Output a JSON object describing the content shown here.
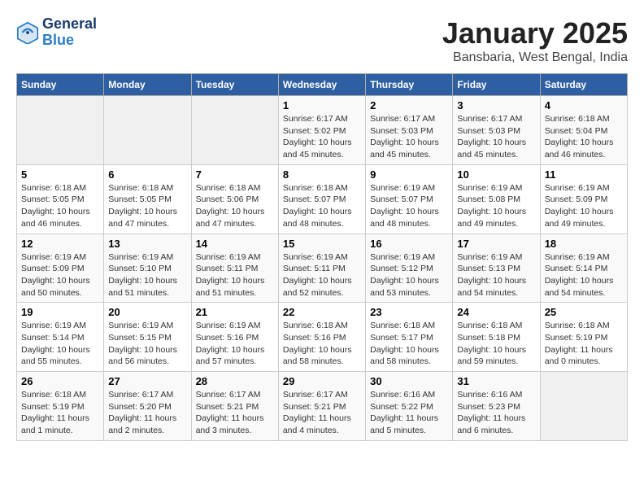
{
  "logo": {
    "line1": "General",
    "line2": "Blue"
  },
  "title": "January 2025",
  "subtitle": "Bansbaria, West Bengal, India",
  "weekdays": [
    "Sunday",
    "Monday",
    "Tuesday",
    "Wednesday",
    "Thursday",
    "Friday",
    "Saturday"
  ],
  "weeks": [
    [
      {
        "day": "",
        "info": ""
      },
      {
        "day": "",
        "info": ""
      },
      {
        "day": "",
        "info": ""
      },
      {
        "day": "1",
        "info": "Sunrise: 6:17 AM\nSunset: 5:02 PM\nDaylight: 10 hours\nand 45 minutes."
      },
      {
        "day": "2",
        "info": "Sunrise: 6:17 AM\nSunset: 5:03 PM\nDaylight: 10 hours\nand 45 minutes."
      },
      {
        "day": "3",
        "info": "Sunrise: 6:17 AM\nSunset: 5:03 PM\nDaylight: 10 hours\nand 45 minutes."
      },
      {
        "day": "4",
        "info": "Sunrise: 6:18 AM\nSunset: 5:04 PM\nDaylight: 10 hours\nand 46 minutes."
      }
    ],
    [
      {
        "day": "5",
        "info": "Sunrise: 6:18 AM\nSunset: 5:05 PM\nDaylight: 10 hours\nand 46 minutes."
      },
      {
        "day": "6",
        "info": "Sunrise: 6:18 AM\nSunset: 5:05 PM\nDaylight: 10 hours\nand 47 minutes."
      },
      {
        "day": "7",
        "info": "Sunrise: 6:18 AM\nSunset: 5:06 PM\nDaylight: 10 hours\nand 47 minutes."
      },
      {
        "day": "8",
        "info": "Sunrise: 6:18 AM\nSunset: 5:07 PM\nDaylight: 10 hours\nand 48 minutes."
      },
      {
        "day": "9",
        "info": "Sunrise: 6:19 AM\nSunset: 5:07 PM\nDaylight: 10 hours\nand 48 minutes."
      },
      {
        "day": "10",
        "info": "Sunrise: 6:19 AM\nSunset: 5:08 PM\nDaylight: 10 hours\nand 49 minutes."
      },
      {
        "day": "11",
        "info": "Sunrise: 6:19 AM\nSunset: 5:09 PM\nDaylight: 10 hours\nand 49 minutes."
      }
    ],
    [
      {
        "day": "12",
        "info": "Sunrise: 6:19 AM\nSunset: 5:09 PM\nDaylight: 10 hours\nand 50 minutes."
      },
      {
        "day": "13",
        "info": "Sunrise: 6:19 AM\nSunset: 5:10 PM\nDaylight: 10 hours\nand 51 minutes."
      },
      {
        "day": "14",
        "info": "Sunrise: 6:19 AM\nSunset: 5:11 PM\nDaylight: 10 hours\nand 51 minutes."
      },
      {
        "day": "15",
        "info": "Sunrise: 6:19 AM\nSunset: 5:11 PM\nDaylight: 10 hours\nand 52 minutes."
      },
      {
        "day": "16",
        "info": "Sunrise: 6:19 AM\nSunset: 5:12 PM\nDaylight: 10 hours\nand 53 minutes."
      },
      {
        "day": "17",
        "info": "Sunrise: 6:19 AM\nSunset: 5:13 PM\nDaylight: 10 hours\nand 54 minutes."
      },
      {
        "day": "18",
        "info": "Sunrise: 6:19 AM\nSunset: 5:14 PM\nDaylight: 10 hours\nand 54 minutes."
      }
    ],
    [
      {
        "day": "19",
        "info": "Sunrise: 6:19 AM\nSunset: 5:14 PM\nDaylight: 10 hours\nand 55 minutes."
      },
      {
        "day": "20",
        "info": "Sunrise: 6:19 AM\nSunset: 5:15 PM\nDaylight: 10 hours\nand 56 minutes."
      },
      {
        "day": "21",
        "info": "Sunrise: 6:19 AM\nSunset: 5:16 PM\nDaylight: 10 hours\nand 57 minutes."
      },
      {
        "day": "22",
        "info": "Sunrise: 6:18 AM\nSunset: 5:16 PM\nDaylight: 10 hours\nand 58 minutes."
      },
      {
        "day": "23",
        "info": "Sunrise: 6:18 AM\nSunset: 5:17 PM\nDaylight: 10 hours\nand 58 minutes."
      },
      {
        "day": "24",
        "info": "Sunrise: 6:18 AM\nSunset: 5:18 PM\nDaylight: 10 hours\nand 59 minutes."
      },
      {
        "day": "25",
        "info": "Sunrise: 6:18 AM\nSunset: 5:19 PM\nDaylight: 11 hours\nand 0 minutes."
      }
    ],
    [
      {
        "day": "26",
        "info": "Sunrise: 6:18 AM\nSunset: 5:19 PM\nDaylight: 11 hours\nand 1 minute."
      },
      {
        "day": "27",
        "info": "Sunrise: 6:17 AM\nSunset: 5:20 PM\nDaylight: 11 hours\nand 2 minutes."
      },
      {
        "day": "28",
        "info": "Sunrise: 6:17 AM\nSunset: 5:21 PM\nDaylight: 11 hours\nand 3 minutes."
      },
      {
        "day": "29",
        "info": "Sunrise: 6:17 AM\nSunset: 5:21 PM\nDaylight: 11 hours\nand 4 minutes."
      },
      {
        "day": "30",
        "info": "Sunrise: 6:16 AM\nSunset: 5:22 PM\nDaylight: 11 hours\nand 5 minutes."
      },
      {
        "day": "31",
        "info": "Sunrise: 6:16 AM\nSunset: 5:23 PM\nDaylight: 11 hours\nand 6 minutes."
      },
      {
        "day": "",
        "info": ""
      }
    ]
  ]
}
